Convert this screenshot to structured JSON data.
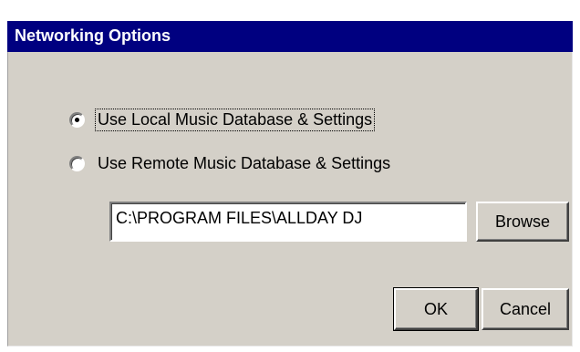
{
  "dialog": {
    "title": "Networking Options"
  },
  "options": [
    {
      "label": "Use Local Music Database & Settings",
      "selected": true
    },
    {
      "label": "Use Remote Music Database & Settings",
      "selected": false
    }
  ],
  "path_field": {
    "value": "C:\\PROGRAM FILES\\ALLDAY DJ"
  },
  "buttons": {
    "browse": "Browse",
    "ok": "OK",
    "cancel": "Cancel"
  },
  "colors": {
    "title_bar": "#000080",
    "face": "#d4d0c8"
  }
}
